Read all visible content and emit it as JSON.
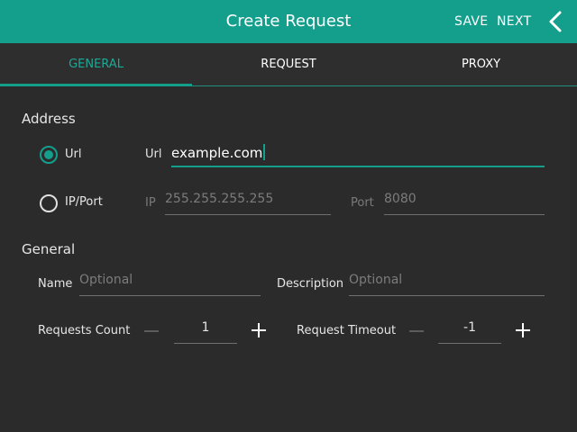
{
  "header": {
    "title": "Create Request",
    "save_label": "SAVE",
    "next_label": "NEXT"
  },
  "tabs": [
    {
      "label": "GENERAL",
      "active": true
    },
    {
      "label": "REQUEST",
      "active": false
    },
    {
      "label": "PROXY",
      "active": false
    }
  ],
  "address": {
    "title": "Address",
    "url_option": "Url",
    "ipport_option": "IP/Port",
    "selected": "Url",
    "url_label": "Url",
    "url_value": "example.com",
    "ip_label": "IP",
    "ip_placeholder": "255.255.255.255",
    "port_label": "Port",
    "port_placeholder": "8080"
  },
  "general": {
    "title": "General",
    "name_label": "Name",
    "name_placeholder": "Optional",
    "description_label": "Description",
    "description_placeholder": "Optional",
    "requests_count_label": "Requests Count",
    "requests_count_value": "1",
    "request_timeout_label": "Request Timeout",
    "request_timeout_value": "-1"
  },
  "colors": {
    "accent": "#149e8c",
    "background": "#2b2b2b"
  },
  "icons": {
    "back": "chevron-left-icon",
    "minus": "minus-icon",
    "plus": "plus-icon"
  }
}
